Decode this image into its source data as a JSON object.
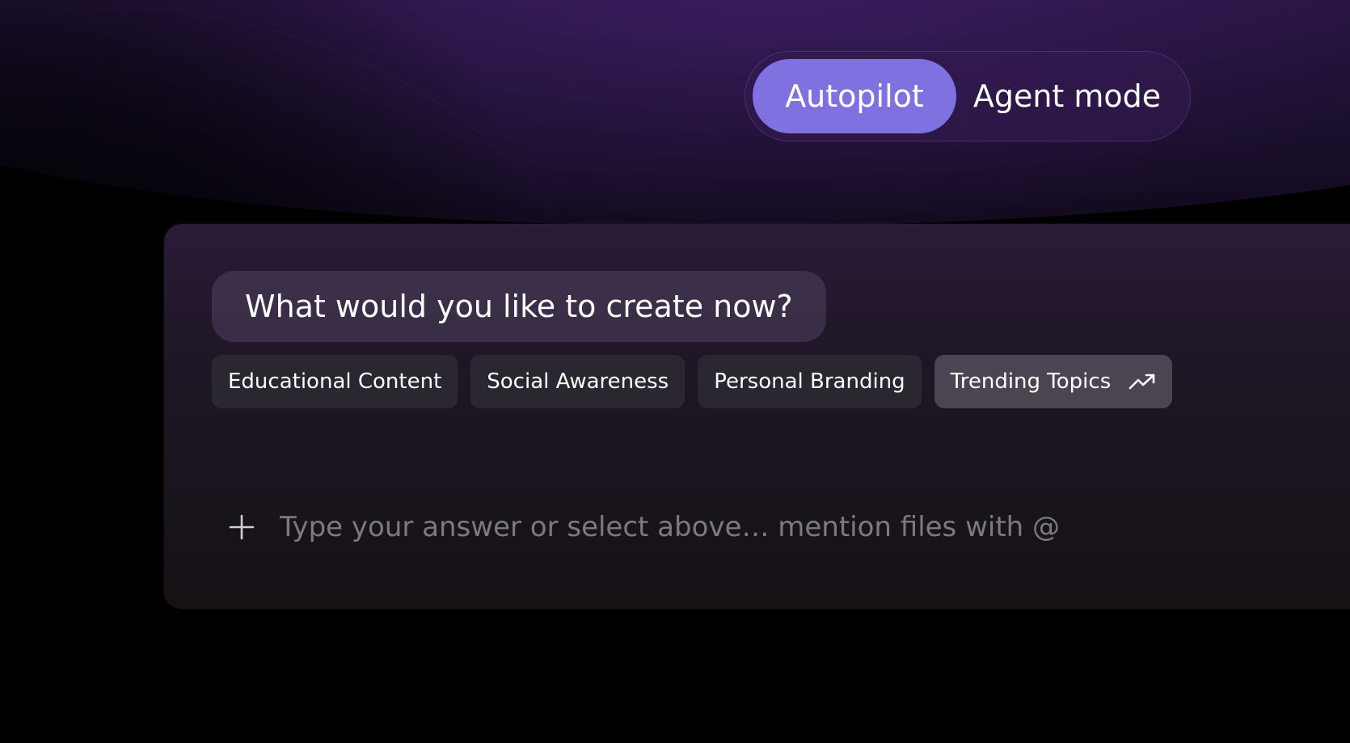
{
  "mode_toggle": {
    "active_label": "Autopilot",
    "inactive_label": "Agent mode"
  },
  "prompt": {
    "question": "What would you like to create now?"
  },
  "suggestions": [
    {
      "label": "Educational Content"
    },
    {
      "label": "Social Awareness"
    },
    {
      "label": "Personal Branding"
    },
    {
      "label": "Trending Topics",
      "icon": "trending-up-icon"
    }
  ],
  "composer": {
    "placeholder": "Type your answer or select above… mention files with @",
    "add_icon": "plus-icon"
  },
  "colors": {
    "accent": "#7f72e0",
    "panel": "#1d1624",
    "chip": "#2b2731",
    "chip_highlight": "#4a4550",
    "glow": "#3e1d62"
  }
}
